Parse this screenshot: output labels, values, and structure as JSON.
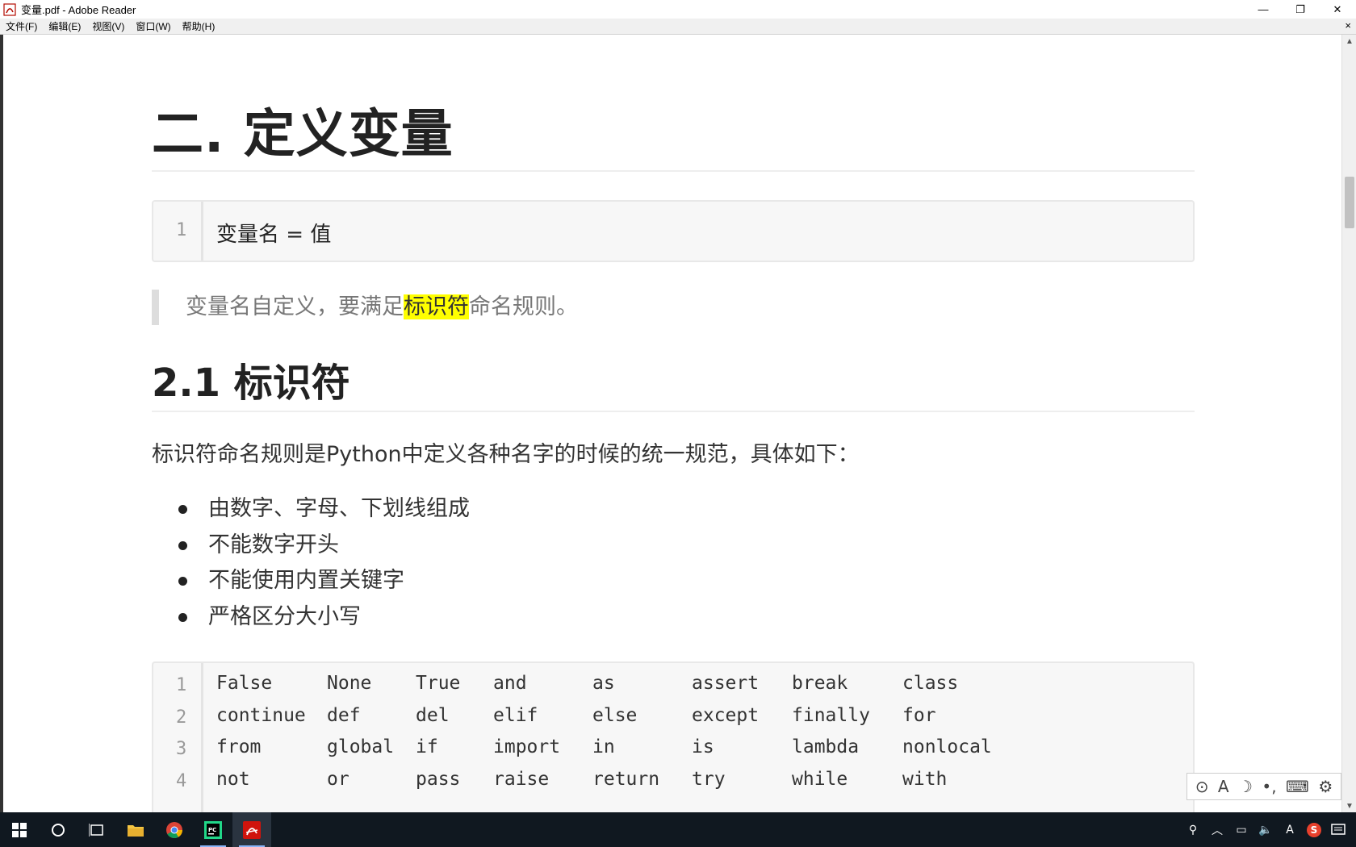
{
  "window": {
    "title": "变量.pdf - Adobe Reader",
    "minimize": "—",
    "restore": "❐",
    "close": "✕"
  },
  "menu": {
    "items": [
      "文件(F)",
      "编辑(E)",
      "视图(V)",
      "窗口(W)",
      "帮助(H)"
    ],
    "close": "×"
  },
  "doc": {
    "section_title": "二. 定义变量",
    "code1": {
      "line_no": "1",
      "code": "变量名 = 值"
    },
    "quote_before": "变量名自定义，要满足",
    "quote_highlight": "标识符",
    "quote_after": "命名规则。",
    "sub_title": "2.1 标识符",
    "paragraph": "标识符命名规则是Python中定义各种名字的时候的统一规范，具体如下：",
    "bullets": [
      "由数字、字母、下划线组成",
      "不能数字开头",
      "不能使用内置关键字",
      "严格区分大小写"
    ],
    "keywords": {
      "line_numbers": [
        "1",
        "2",
        "3",
        "4"
      ],
      "rows": [
        [
          "False",
          "None",
          "True",
          "and",
          "as",
          "assert",
          "break",
          "class"
        ],
        [
          "continue",
          "def",
          "del",
          "elif",
          "else",
          "except",
          "finally",
          "for"
        ],
        [
          "from",
          "global",
          "if",
          "import",
          "in",
          "is",
          "lambda",
          "nonlocal"
        ],
        [
          "not",
          "or",
          "pass",
          "raise",
          "return",
          "try",
          "while",
          "with"
        ]
      ]
    }
  },
  "ime": {
    "items": [
      "⊙",
      "A",
      "☽",
      "•,",
      "⌨",
      "⚙"
    ]
  },
  "taskbar": {
    "tray_text_a": "A",
    "tray_sogou": "S"
  },
  "colors": {
    "highlight": "#ffff00",
    "taskbar": "#101820"
  }
}
